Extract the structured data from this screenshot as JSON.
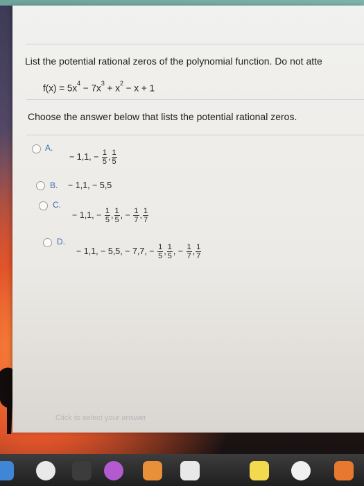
{
  "question": {
    "text": "List the potential rational zeros of the polynomial function. Do not atte",
    "function_label": "f(x) = 5x",
    "exp1": "4",
    "term2": " − 7x",
    "exp2": "3",
    "term3": " + x",
    "exp3": "2",
    "term4": " − x + 1"
  },
  "prompt": "Choose the answer below that lists the potential rational zeros.",
  "options": [
    {
      "letter": "A.",
      "prefix": "− 1,1, −",
      "f1n": "1",
      "f1d": "5",
      "f2n": "1",
      "f2d": "5"
    },
    {
      "letter": "B.",
      "text": "− 1,1, − 5,5"
    },
    {
      "letter": "C.",
      "prefix": "− 1,1, −",
      "f1n": "1",
      "f1d": "5",
      "f2n": "1",
      "f2d": "5",
      "mid": "−",
      "f3n": "1",
      "f3d": "7",
      "f4n": "1",
      "f4d": "7"
    },
    {
      "letter": "D.",
      "prefix": "− 1,1, − 5,5, − 7,7, −",
      "f1n": "1",
      "f1d": "5",
      "f2n": "1",
      "f2d": "5",
      "mid": "−",
      "f3n": "1",
      "f3d": "7",
      "f4n": "1",
      "f4d": "7"
    }
  ],
  "hint": "Click to select your answer",
  "dock": {
    "icons": [
      "finder-icon",
      "chrome-icon",
      "launchpad-icon",
      "podcasts-icon",
      "photo-app-icon",
      "news-icon",
      "notes-icon",
      "photos-icon",
      "ibooks-icon"
    ],
    "colors": [
      "#3f86d6",
      "#e9e9e9",
      "#3c3c3c",
      "#b35ad0",
      "#e88f3a",
      "#e8e8e8",
      "#f2d94e",
      "#f0f0f0",
      "#e8782f"
    ]
  }
}
